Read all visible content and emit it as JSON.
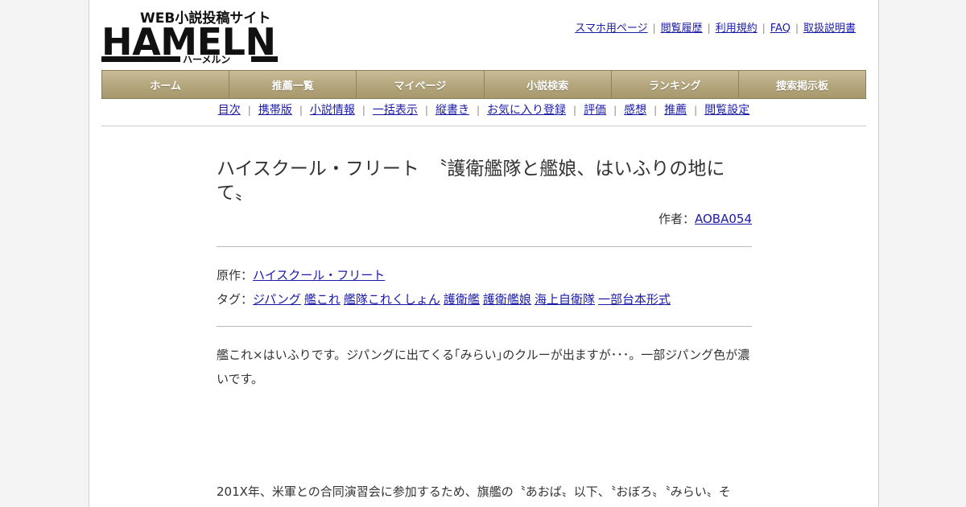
{
  "logo": {
    "top_text": "WEB小説投稿サイト",
    "main_text": "HAMELN",
    "sub_text": "ハーメルン"
  },
  "toplinks": [
    "スマホ用ページ",
    "閲覧履歴",
    "利用規約",
    "FAQ",
    "取扱説明書"
  ],
  "mainnav": [
    "ホーム",
    "推薦一覧",
    "マイページ",
    "小説検索",
    "ランキング",
    "捜索掲示板"
  ],
  "subnav": [
    "目次",
    "携帯版",
    "小説情報",
    "一括表示",
    "縦書き",
    "お気に入り登録",
    "評価",
    "感想",
    "推薦",
    "閲覧設定"
  ],
  "novel": {
    "title": "ハイスクール・フリート　〝護衛艦隊と艦娘、はいふりの地にて〟",
    "author_label": "作者：",
    "author": "AOBA054",
    "original_label": "原作：",
    "original": "ハイスクール・フリート",
    "tags_label": "タグ：",
    "tags": [
      "ジパング",
      "艦これ",
      "艦隊これくしょん",
      "護衛艦",
      "護衛艦娘",
      "海上自衛隊",
      "一部台本形式"
    ],
    "summary": "艦これ×はいふりです。ジパングに出てくる｢みらい｣のクルーが出ますが･･･。一部ジパング色が濃いです。",
    "body_first_line": "201X年、米軍との合同演習会に参加するため、旗艦の〝あおば〟以下、〝おぼろ〟〝みらい〟そ"
  },
  "colors": {
    "nav_bg": "#b3a57c",
    "link": "#1a1aa8"
  }
}
